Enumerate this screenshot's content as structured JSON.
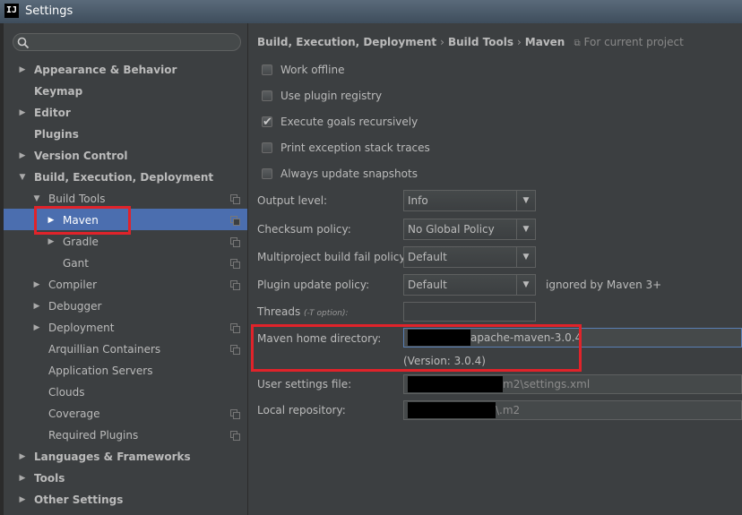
{
  "window": {
    "title": "Settings",
    "app_icon_text": "IJ"
  },
  "search": {
    "placeholder": ""
  },
  "tree": {
    "appearance": "Appearance & Behavior",
    "keymap": "Keymap",
    "editor": "Editor",
    "plugins": "Plugins",
    "version_control": "Version Control",
    "build_exec_deploy": "Build, Execution, Deployment",
    "build_tools": "Build Tools",
    "maven": "Maven",
    "gradle": "Gradle",
    "gant": "Gant",
    "compiler": "Compiler",
    "debugger": "Debugger",
    "deployment": "Deployment",
    "arquillian": "Arquillian Containers",
    "app_servers": "Application Servers",
    "clouds": "Clouds",
    "coverage": "Coverage",
    "required_plugins": "Required Plugins",
    "languages": "Languages & Frameworks",
    "tools": "Tools",
    "other": "Other Settings"
  },
  "breadcrumb": {
    "part1": "Build, Execution, Deployment",
    "sep": "›",
    "part2": "Build Tools",
    "part3": "Maven",
    "scope": "For current project"
  },
  "options": {
    "work_offline": {
      "label": "Work offline",
      "checked": false
    },
    "use_plugin_registry": {
      "label": "Use plugin registry",
      "checked": false
    },
    "execute_goals": {
      "label": "Execute goals recursively",
      "checked": true
    },
    "print_exception": {
      "label": "Print exception stack traces",
      "checked": false
    },
    "always_update": {
      "label": "Always update snapshots",
      "checked": false
    }
  },
  "fields": {
    "output_level": {
      "label": "Output level:",
      "value": "Info"
    },
    "checksum_policy": {
      "label": "Checksum policy:",
      "value": "No Global Policy"
    },
    "multiproject_policy": {
      "label": "Multiproject build fail policy:",
      "value": "Default"
    },
    "plugin_update_policy": {
      "label": "Plugin update policy:",
      "value": "Default",
      "note": "ignored by Maven 3+"
    },
    "threads": {
      "label": "Threads",
      "hint": "(-T option):",
      "value": ""
    },
    "maven_home": {
      "label": "Maven home directory:",
      "value": "apache-maven-3.0.4",
      "version": "(Version: 3.0.4)"
    },
    "user_settings": {
      "label": "User settings file:",
      "value": "m2\\settings.xml"
    },
    "local_repo": {
      "label": "Local repository:",
      "value": "\\.m2"
    }
  },
  "colors": {
    "background": "#3c3f41",
    "selection": "#4b6eaf",
    "highlight": "#e0232a"
  }
}
